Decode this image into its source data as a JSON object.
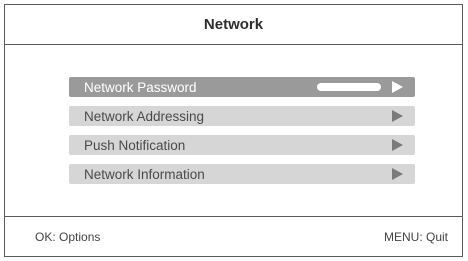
{
  "header": {
    "title": "Network"
  },
  "menu": {
    "selected_index": 0,
    "items": [
      {
        "label": "Network Password",
        "icon": "right-arrow-icon"
      },
      {
        "label": "Network Addressing",
        "icon": "right-arrow-icon"
      },
      {
        "label": "Push Notification",
        "icon": "right-arrow-icon"
      },
      {
        "label": "Network Information",
        "icon": "right-arrow-icon"
      }
    ]
  },
  "footer": {
    "left_hint": "OK: Options",
    "right_hint": "MENU: Quit"
  },
  "colors": {
    "selected_bg": "#9a9a9a",
    "item_bg": "#d6d6d6",
    "border": "#5a5a5a"
  }
}
